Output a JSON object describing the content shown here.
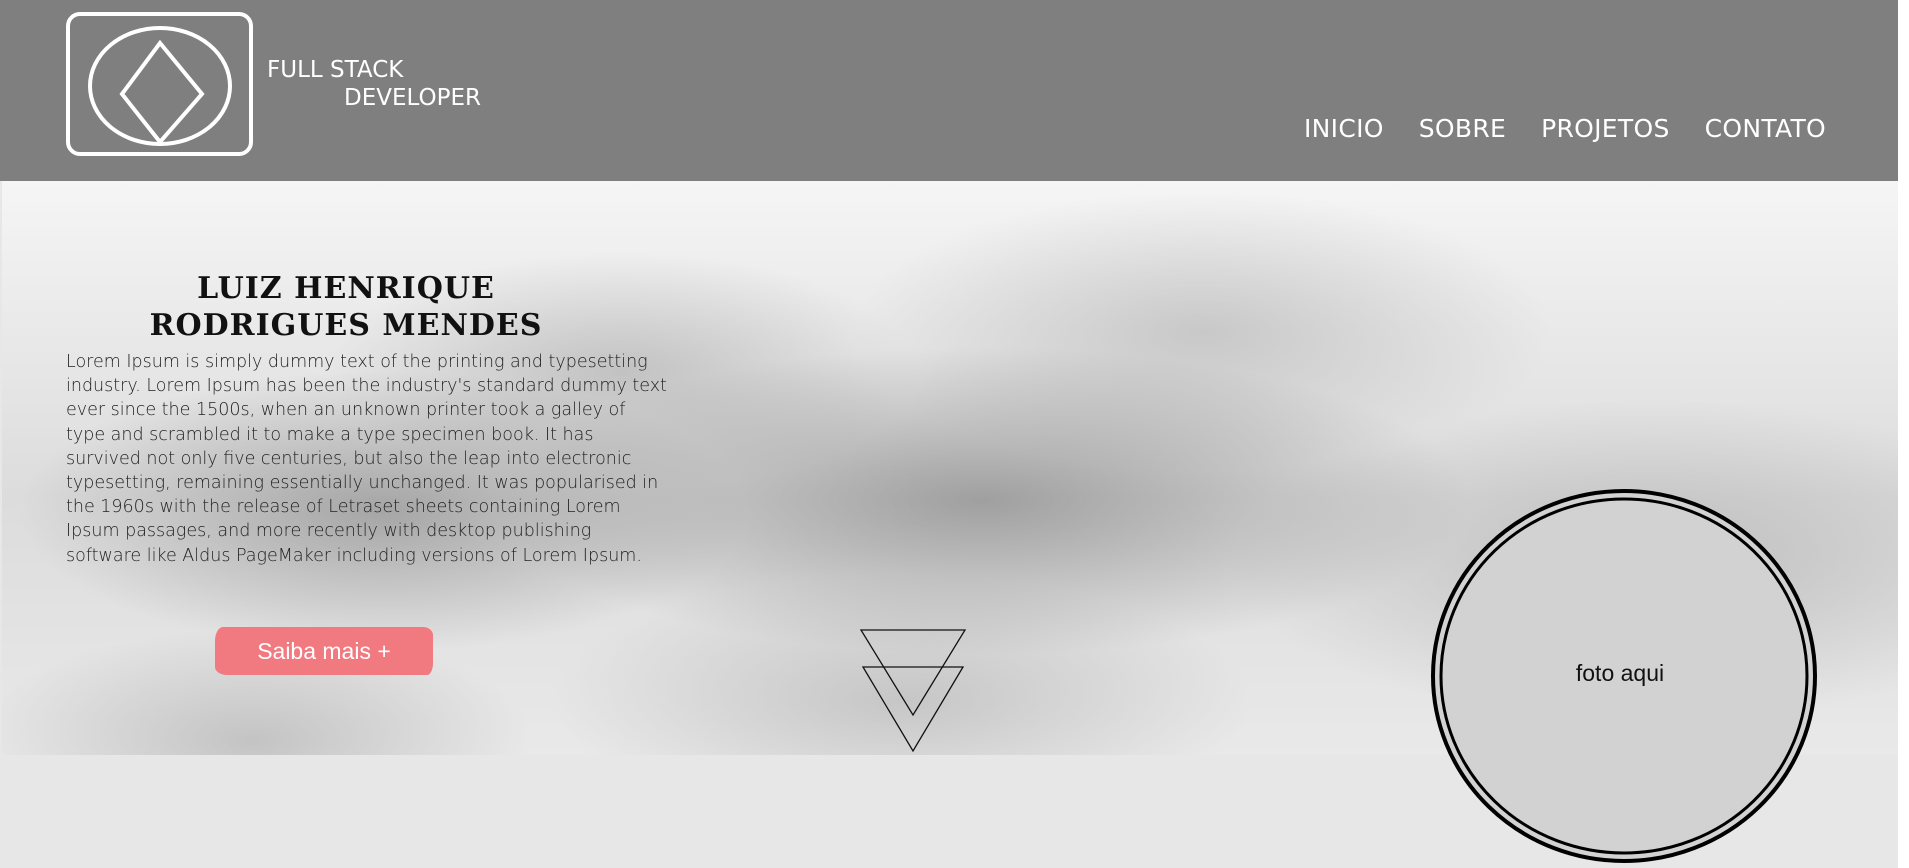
{
  "header": {
    "brand_line1": "FULL STACK",
    "brand_line2": "DEVELOPER",
    "logo_icon": "diamond-in-oval-icon",
    "nav": [
      {
        "label": "INICIO"
      },
      {
        "label": "SOBRE"
      },
      {
        "label": "PROJETOS"
      },
      {
        "label": "CONTATO"
      }
    ]
  },
  "hero": {
    "title_line1": "LUIZ HENRIQUE",
    "title_line2": "RODRIGUES MENDES",
    "body": "Lorem Ipsum is simply dummy text of the printing and typesetting industry. Lorem Ipsum has been the industry's standard dummy text ever since the 1500s, when an unknown printer took a galley of type and scrambled it to make a type specimen book. It has survived not only five centuries, but also the leap into electronic typesetting, remaining essentially unchanged. It was popularised in the 1960s with the release of Letraset sheets containing Lorem Ipsum passages, and more recently with desktop publishing software like Aldus PageMaker including versions of Lorem Ipsum.",
    "cta_label": "Saiba mais +",
    "scroll_icon": "double-triangle-down-icon"
  },
  "photo": {
    "placeholder": "foto aqui"
  },
  "colors": {
    "header_bg": "#7f7f7f",
    "accent": "#f07a80",
    "footer_bg": "#e7e7e7"
  }
}
